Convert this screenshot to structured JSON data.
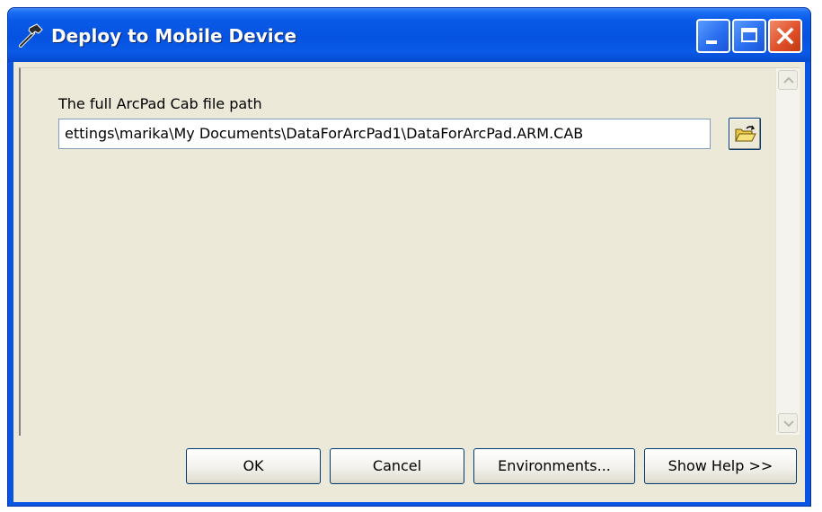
{
  "window": {
    "title": "Deploy to Mobile Device",
    "title_icon": "hammer-icon",
    "controls": [
      "minimize-icon",
      "maximize-icon",
      "close-icon"
    ]
  },
  "parameters": {
    "cab_path": {
      "label": "The full ArcPad Cab file path",
      "value": "ettings\\marika\\My Documents\\DataForArcPad1\\DataForArcPad.ARM.CAB",
      "browse_icon": "open-folder-icon"
    }
  },
  "buttons": {
    "ok": "OK",
    "cancel": "Cancel",
    "environments": "Environments...",
    "show_help": "Show Help >>"
  },
  "colors": {
    "titlebar": "#0a54e3",
    "dialog_bg": "#ece9d8",
    "close_button": "#e0502a"
  }
}
